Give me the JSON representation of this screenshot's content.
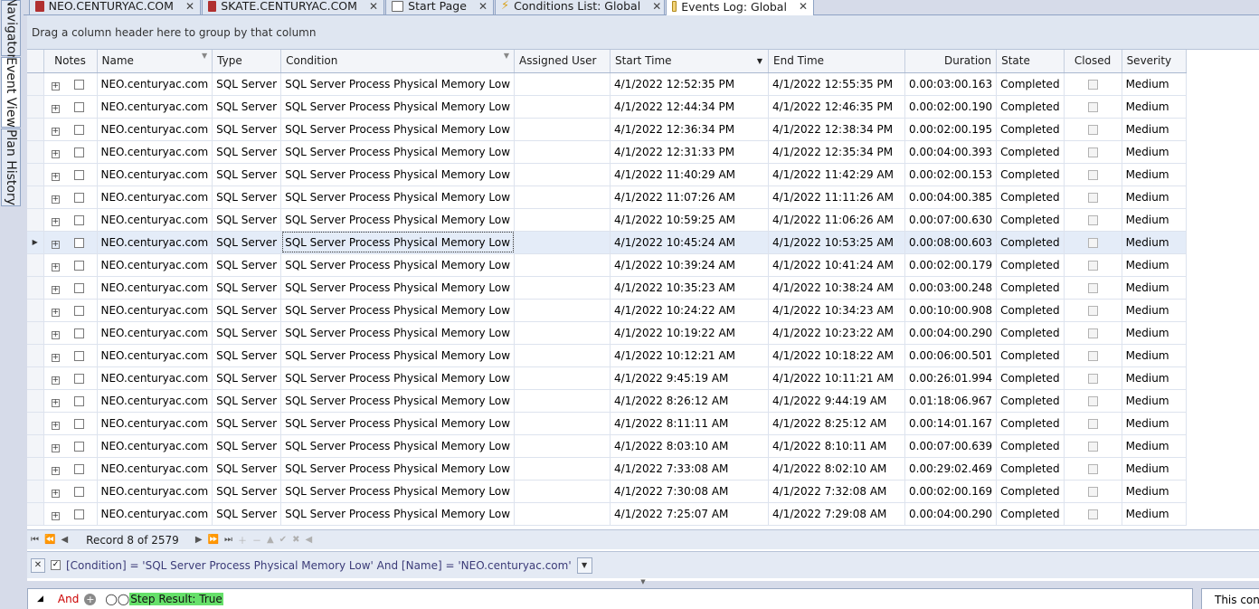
{
  "dock": {
    "tabs": [
      {
        "label": "Navigator"
      },
      {
        "label": "Event View"
      },
      {
        "label": "Plan History"
      }
    ]
  },
  "tabs": [
    {
      "label": "NEO.CENTURYAC.COM",
      "icon": "server-icon",
      "color": "#b03030"
    },
    {
      "label": "SKATE.CENTURYAC.COM",
      "icon": "server-icon",
      "color": "#b03030"
    },
    {
      "label": "Start Page",
      "icon": "grid-icon",
      "color": "#6a6a6a"
    },
    {
      "label": "Conditions List: Global",
      "icon": "lightning-icon",
      "color": "#d9a21c"
    },
    {
      "label": "Events Log: Global",
      "icon": "log-icon",
      "color": "#d9a21c"
    }
  ],
  "group_hint": "Drag a column header here to group by that column",
  "columns": {
    "notes": "Notes",
    "name": "Name",
    "type": "Type",
    "condition": "Condition",
    "assigned_user": "Assigned User",
    "start_time": "Start Time",
    "end_time": "End Time",
    "duration": "Duration",
    "state": "State",
    "closed": "Closed",
    "severity": "Severity"
  },
  "rows": [
    {
      "name": "NEO.centuryac.com",
      "type": "SQL Server",
      "condition": "SQL Server Process Physical Memory Low",
      "assigned": "",
      "start": "4/1/2022 12:52:35 PM",
      "end": "4/1/2022 12:55:35 PM",
      "duration": "0.00:03:00.163",
      "state": "Completed",
      "severity": "Medium"
    },
    {
      "name": "NEO.centuryac.com",
      "type": "SQL Server",
      "condition": "SQL Server Process Physical Memory Low",
      "assigned": "",
      "start": "4/1/2022 12:44:34 PM",
      "end": "4/1/2022 12:46:35 PM",
      "duration": "0.00:02:00.190",
      "state": "Completed",
      "severity": "Medium"
    },
    {
      "name": "NEO.centuryac.com",
      "type": "SQL Server",
      "condition": "SQL Server Process Physical Memory Low",
      "assigned": "",
      "start": "4/1/2022 12:36:34 PM",
      "end": "4/1/2022 12:38:34 PM",
      "duration": "0.00:02:00.195",
      "state": "Completed",
      "severity": "Medium"
    },
    {
      "name": "NEO.centuryac.com",
      "type": "SQL Server",
      "condition": "SQL Server Process Physical Memory Low",
      "assigned": "",
      "start": "4/1/2022 12:31:33 PM",
      "end": "4/1/2022 12:35:34 PM",
      "duration": "0.00:04:00.393",
      "state": "Completed",
      "severity": "Medium"
    },
    {
      "name": "NEO.centuryac.com",
      "type": "SQL Server",
      "condition": "SQL Server Process Physical Memory Low",
      "assigned": "",
      "start": "4/1/2022 11:40:29 AM",
      "end": "4/1/2022 11:42:29 AM",
      "duration": "0.00:02:00.153",
      "state": "Completed",
      "severity": "Medium"
    },
    {
      "name": "NEO.centuryac.com",
      "type": "SQL Server",
      "condition": "SQL Server Process Physical Memory Low",
      "assigned": "",
      "start": "4/1/2022 11:07:26 AM",
      "end": "4/1/2022 11:11:26 AM",
      "duration": "0.00:04:00.385",
      "state": "Completed",
      "severity": "Medium"
    },
    {
      "name": "NEO.centuryac.com",
      "type": "SQL Server",
      "condition": "SQL Server Process Physical Memory Low",
      "assigned": "",
      "start": "4/1/2022 10:59:25 AM",
      "end": "4/1/2022 11:06:26 AM",
      "duration": "0.00:07:00.630",
      "state": "Completed",
      "severity": "Medium"
    },
    {
      "name": "NEO.centuryac.com",
      "type": "SQL Server",
      "condition": "SQL Server Process Physical Memory Low",
      "assigned": "",
      "start": "4/1/2022 10:45:24 AM",
      "end": "4/1/2022 10:53:25 AM",
      "duration": "0.00:08:00.603",
      "state": "Completed",
      "severity": "Medium"
    },
    {
      "name": "NEO.centuryac.com",
      "type": "SQL Server",
      "condition": "SQL Server Process Physical Memory Low",
      "assigned": "",
      "start": "4/1/2022 10:39:24 AM",
      "end": "4/1/2022 10:41:24 AM",
      "duration": "0.00:02:00.179",
      "state": "Completed",
      "severity": "Medium"
    },
    {
      "name": "NEO.centuryac.com",
      "type": "SQL Server",
      "condition": "SQL Server Process Physical Memory Low",
      "assigned": "",
      "start": "4/1/2022 10:35:23 AM",
      "end": "4/1/2022 10:38:24 AM",
      "duration": "0.00:03:00.248",
      "state": "Completed",
      "severity": "Medium"
    },
    {
      "name": "NEO.centuryac.com",
      "type": "SQL Server",
      "condition": "SQL Server Process Physical Memory Low",
      "assigned": "",
      "start": "4/1/2022 10:24:22 AM",
      "end": "4/1/2022 10:34:23 AM",
      "duration": "0.00:10:00.908",
      "state": "Completed",
      "severity": "Medium"
    },
    {
      "name": "NEO.centuryac.com",
      "type": "SQL Server",
      "condition": "SQL Server Process Physical Memory Low",
      "assigned": "",
      "start": "4/1/2022 10:19:22 AM",
      "end": "4/1/2022 10:23:22 AM",
      "duration": "0.00:04:00.290",
      "state": "Completed",
      "severity": "Medium"
    },
    {
      "name": "NEO.centuryac.com",
      "type": "SQL Server",
      "condition": "SQL Server Process Physical Memory Low",
      "assigned": "",
      "start": "4/1/2022 10:12:21 AM",
      "end": "4/1/2022 10:18:22 AM",
      "duration": "0.00:06:00.501",
      "state": "Completed",
      "severity": "Medium"
    },
    {
      "name": "NEO.centuryac.com",
      "type": "SQL Server",
      "condition": "SQL Server Process Physical Memory Low",
      "assigned": "",
      "start": "4/1/2022 9:45:19 AM",
      "end": "4/1/2022 10:11:21 AM",
      "duration": "0.00:26:01.994",
      "state": "Completed",
      "severity": "Medium"
    },
    {
      "name": "NEO.centuryac.com",
      "type": "SQL Server",
      "condition": "SQL Server Process Physical Memory Low",
      "assigned": "",
      "start": "4/1/2022 8:26:12 AM",
      "end": "4/1/2022 9:44:19 AM",
      "duration": "0.01:18:06.967",
      "state": "Completed",
      "severity": "Medium"
    },
    {
      "name": "NEO.centuryac.com",
      "type": "SQL Server",
      "condition": "SQL Server Process Physical Memory Low",
      "assigned": "",
      "start": "4/1/2022 8:11:11 AM",
      "end": "4/1/2022 8:25:12 AM",
      "duration": "0.00:14:01.167",
      "state": "Completed",
      "severity": "Medium"
    },
    {
      "name": "NEO.centuryac.com",
      "type": "SQL Server",
      "condition": "SQL Server Process Physical Memory Low",
      "assigned": "",
      "start": "4/1/2022 8:03:10 AM",
      "end": "4/1/2022 8:10:11 AM",
      "duration": "0.00:07:00.639",
      "state": "Completed",
      "severity": "Medium"
    },
    {
      "name": "NEO.centuryac.com",
      "type": "SQL Server",
      "condition": "SQL Server Process Physical Memory Low",
      "assigned": "",
      "start": "4/1/2022 7:33:08 AM",
      "end": "4/1/2022 8:02:10 AM",
      "duration": "0.00:29:02.469",
      "state": "Completed",
      "severity": "Medium"
    },
    {
      "name": "NEO.centuryac.com",
      "type": "SQL Server",
      "condition": "SQL Server Process Physical Memory Low",
      "assigned": "",
      "start": "4/1/2022 7:30:08 AM",
      "end": "4/1/2022 7:32:08 AM",
      "duration": "0.00:02:00.169",
      "state": "Completed",
      "severity": "Medium"
    },
    {
      "name": "NEO.centuryac.com",
      "type": "SQL Server",
      "condition": "SQL Server Process Physical Memory Low",
      "assigned": "",
      "start": "4/1/2022 7:25:07 AM",
      "end": "4/1/2022 7:29:08 AM",
      "duration": "0.00:04:00.290",
      "state": "Completed",
      "severity": "Medium"
    }
  ],
  "selected_row_number": 8,
  "navigator": {
    "record_text": "Record 8 of 2579"
  },
  "filter": {
    "text": "[Condition] = 'SQL Server Process Physical Memory Low' And [Name] = 'NEO.centuryac.com'"
  },
  "editor": {
    "operator": "And",
    "step_result": "Step Result: True",
    "side_text": "This con"
  }
}
